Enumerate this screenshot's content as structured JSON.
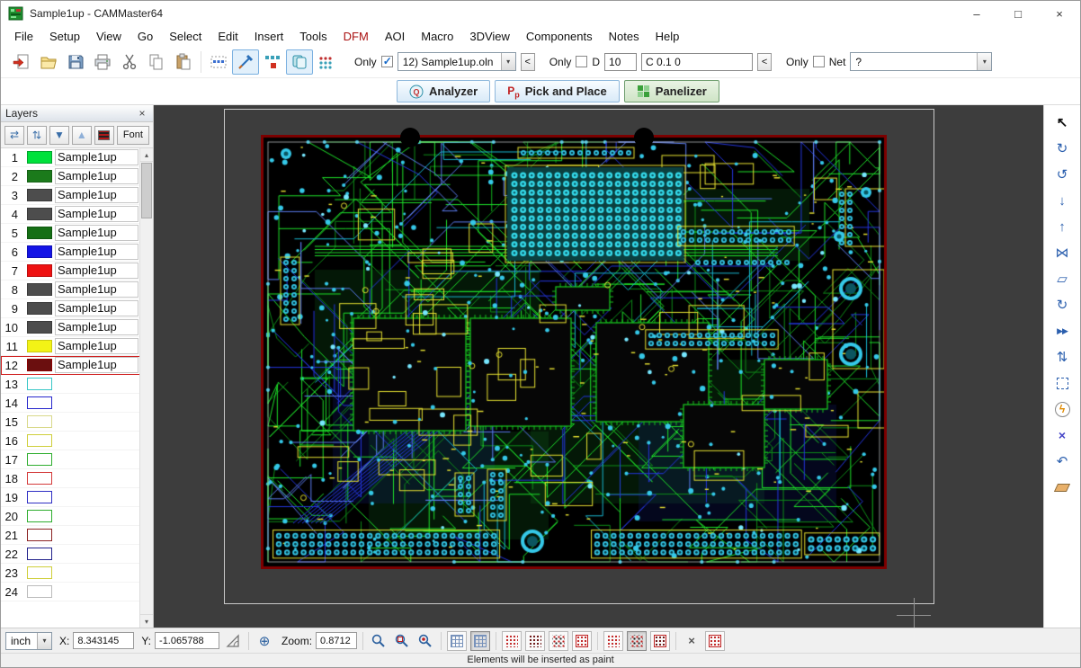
{
  "window": {
    "title": "Sample1up - CAMMaster64"
  },
  "menu": {
    "items": [
      {
        "label": "File"
      },
      {
        "label": "Setup"
      },
      {
        "label": "View"
      },
      {
        "label": "Go"
      },
      {
        "label": "Select"
      },
      {
        "label": "Edit"
      },
      {
        "label": "Insert"
      },
      {
        "label": "Tools"
      },
      {
        "label": "DFM",
        "color": "#aa1111"
      },
      {
        "label": "AOI"
      },
      {
        "label": "Macro"
      },
      {
        "label": "3DView"
      },
      {
        "label": "Components"
      },
      {
        "label": "Notes"
      },
      {
        "label": "Help"
      }
    ]
  },
  "toolbar": {
    "only_layer_label": "Only",
    "layer_select_value": "12) Sample1up.oln",
    "layer_prev_label": "<",
    "only_dcode_label": "Only",
    "dcode_label": "D",
    "dcode_value": "10",
    "dcode_info_value": "C 0.1  0",
    "dcode_prev_label": "<",
    "only_net_label": "Only",
    "net_label": "Net",
    "net_value": "?"
  },
  "ribbon": {
    "analyzer_label": "Analyzer",
    "pick_and_place_label": "Pick and Place",
    "panelizer_label": "Panelizer"
  },
  "layers_panel": {
    "title": "Layers",
    "font_button_label": "Font",
    "rows": [
      {
        "num": "1",
        "fill": "#00e13b",
        "border": "#00a42c",
        "label": "Sample1up"
      },
      {
        "num": "2",
        "fill": "#1b7a1b",
        "border": "#156015",
        "label": "Sample1up"
      },
      {
        "num": "3",
        "fill": "#4d4d4d",
        "border": "#3a3a3a",
        "label": "Sample1up"
      },
      {
        "num": "4",
        "fill": "#4d4d4d",
        "border": "#3a3a3a",
        "label": "Sample1up"
      },
      {
        "num": "5",
        "fill": "#156f15",
        "border": "#0f570f",
        "label": "Sample1up"
      },
      {
        "num": "6",
        "fill": "#1414e6",
        "border": "#0f0fb4",
        "label": "Sample1up"
      },
      {
        "num": "7",
        "fill": "#ee1111",
        "border": "#bb0d0d",
        "label": "Sample1up"
      },
      {
        "num": "8",
        "fill": "#4d4d4d",
        "border": "#3a3a3a",
        "label": "Sample1up"
      },
      {
        "num": "9",
        "fill": "#4d4d4d",
        "border": "#3a3a3a",
        "label": "Sample1up"
      },
      {
        "num": "10",
        "fill": "#4d4d4d",
        "border": "#3a3a3a",
        "label": "Sample1up"
      },
      {
        "num": "11",
        "fill": "#f3f316",
        "border": "#c9c912",
        "label": "Sample1up"
      },
      {
        "num": "12",
        "fill": "#6b0f0f",
        "border": "#8b0000",
        "label": "Sample1up",
        "selected": true
      },
      {
        "num": "13",
        "fill": "#ffffff",
        "border": "#39c7c7",
        "label": ""
      },
      {
        "num": "14",
        "fill": "#ffffff",
        "border": "#2727cc",
        "label": ""
      },
      {
        "num": "15",
        "fill": "#ffffff",
        "border": "#d9d98a",
        "label": ""
      },
      {
        "num": "16",
        "fill": "#ffffff",
        "border": "#cfcf3a",
        "label": ""
      },
      {
        "num": "17",
        "fill": "#ffffff",
        "border": "#2fae2f",
        "label": ""
      },
      {
        "num": "18",
        "fill": "#ffffff",
        "border": "#d43a3a",
        "label": ""
      },
      {
        "num": "19",
        "fill": "#ffffff",
        "border": "#2f2fc4",
        "label": ""
      },
      {
        "num": "20",
        "fill": "#ffffff",
        "border": "#2fae2f",
        "label": ""
      },
      {
        "num": "21",
        "fill": "#ffffff",
        "border": "#8b2222",
        "label": ""
      },
      {
        "num": "22",
        "fill": "#ffffff",
        "border": "#22228b",
        "label": ""
      },
      {
        "num": "23",
        "fill": "#ffffff",
        "border": "#cfcf3a",
        "label": ""
      },
      {
        "num": "24",
        "fill": "#ffffff",
        "border": "#bbbbbb",
        "label": ""
      }
    ]
  },
  "statusbar": {
    "unit_value": "inch",
    "x_label": "X:",
    "x_value": "8.343145",
    "y_label": "Y:",
    "y_value": "-1.065788",
    "zoom_label": "Zoom:",
    "zoom_value": "0.8712"
  },
  "message_bar": {
    "text": "Elements will be inserted as paint"
  },
  "icons": {
    "minimize": "–",
    "maximize": "□",
    "close": "×",
    "dropdown": "▾",
    "panel_close": "×",
    "scroll_up": "▴",
    "scroll_down": "▾",
    "swap_layers": "⇄",
    "move_down": "▼",
    "move_up": "▲",
    "cursor": "↖",
    "rotate_cw": "↻",
    "rotate_ccw": "↺",
    "arrow_down": "↓",
    "arrow_up": "↑",
    "mirror": "⋈",
    "skew": "▱",
    "rotate90": "↻",
    "fast_forward": "▶▶",
    "swap_vert": "⇅",
    "lightning": "ϟ",
    "delete": "×",
    "undo": "↶",
    "origin": "⊕",
    "analyzer_glyph": "Q",
    "pp_main": "P",
    "pp_sub": "p",
    "cancel": "×"
  },
  "pcb": {
    "canvas_bg": "#3d3d3d",
    "board_bg": "#000000",
    "board_border": "#7d0000",
    "trace_green": "#1ee12a",
    "trace_green_dark": "#0e8c18",
    "trace_blue": "#2436df",
    "trace_blue_light": "#5b7cf0",
    "trace_teal": "#18b6cf",
    "pad_cyan": "#35c8e8",
    "silk_yellow": "#e8e332"
  }
}
